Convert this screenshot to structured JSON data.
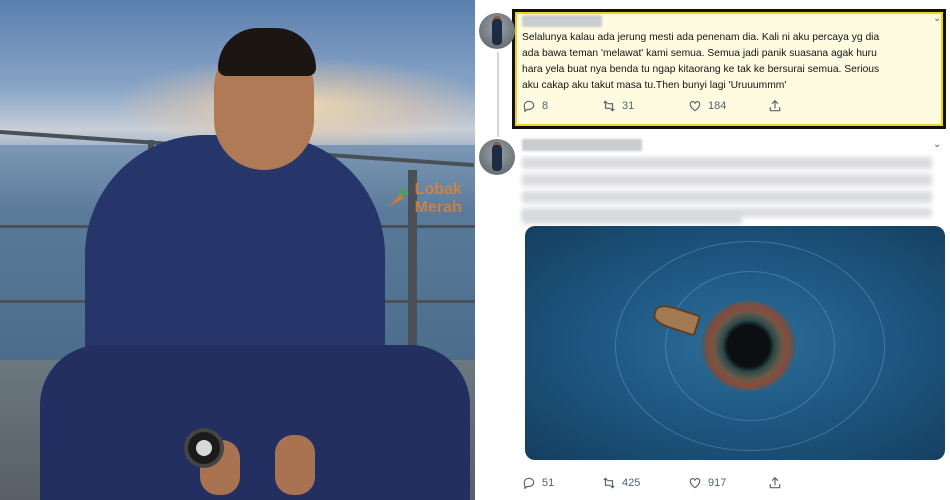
{
  "photo": {
    "watermark": "Lobak Merah"
  },
  "tweets": [
    {
      "text": "Selalunya kalau ada jerung mesti ada penenam dia. Kali ni aku percaya yg dia\nada bawa teman 'melawat' kami semua. Semua jadi panik suasana agak huru\nhara yela buat nya benda tu ngap kitaorang ke tak ke bersurai semua. Serious\naku cakap aku takut masa tu.Then bunyi lagi 'Uruuummm'",
      "replies": "8",
      "retweets": "31",
      "likes": "184"
    },
    {
      "replies": "51",
      "retweets": "425",
      "likes": "917"
    }
  ],
  "icons": {
    "reply": "reply-icon",
    "retweet": "retweet-icon",
    "like": "heart-icon",
    "share": "share-icon",
    "more": "chevron-down-icon",
    "watermark": "carrot-icon"
  },
  "colors": {
    "highlight_border": "#111111",
    "highlight_outline": "#f3d21c",
    "text": "#0f1419",
    "muted": "#536471"
  }
}
